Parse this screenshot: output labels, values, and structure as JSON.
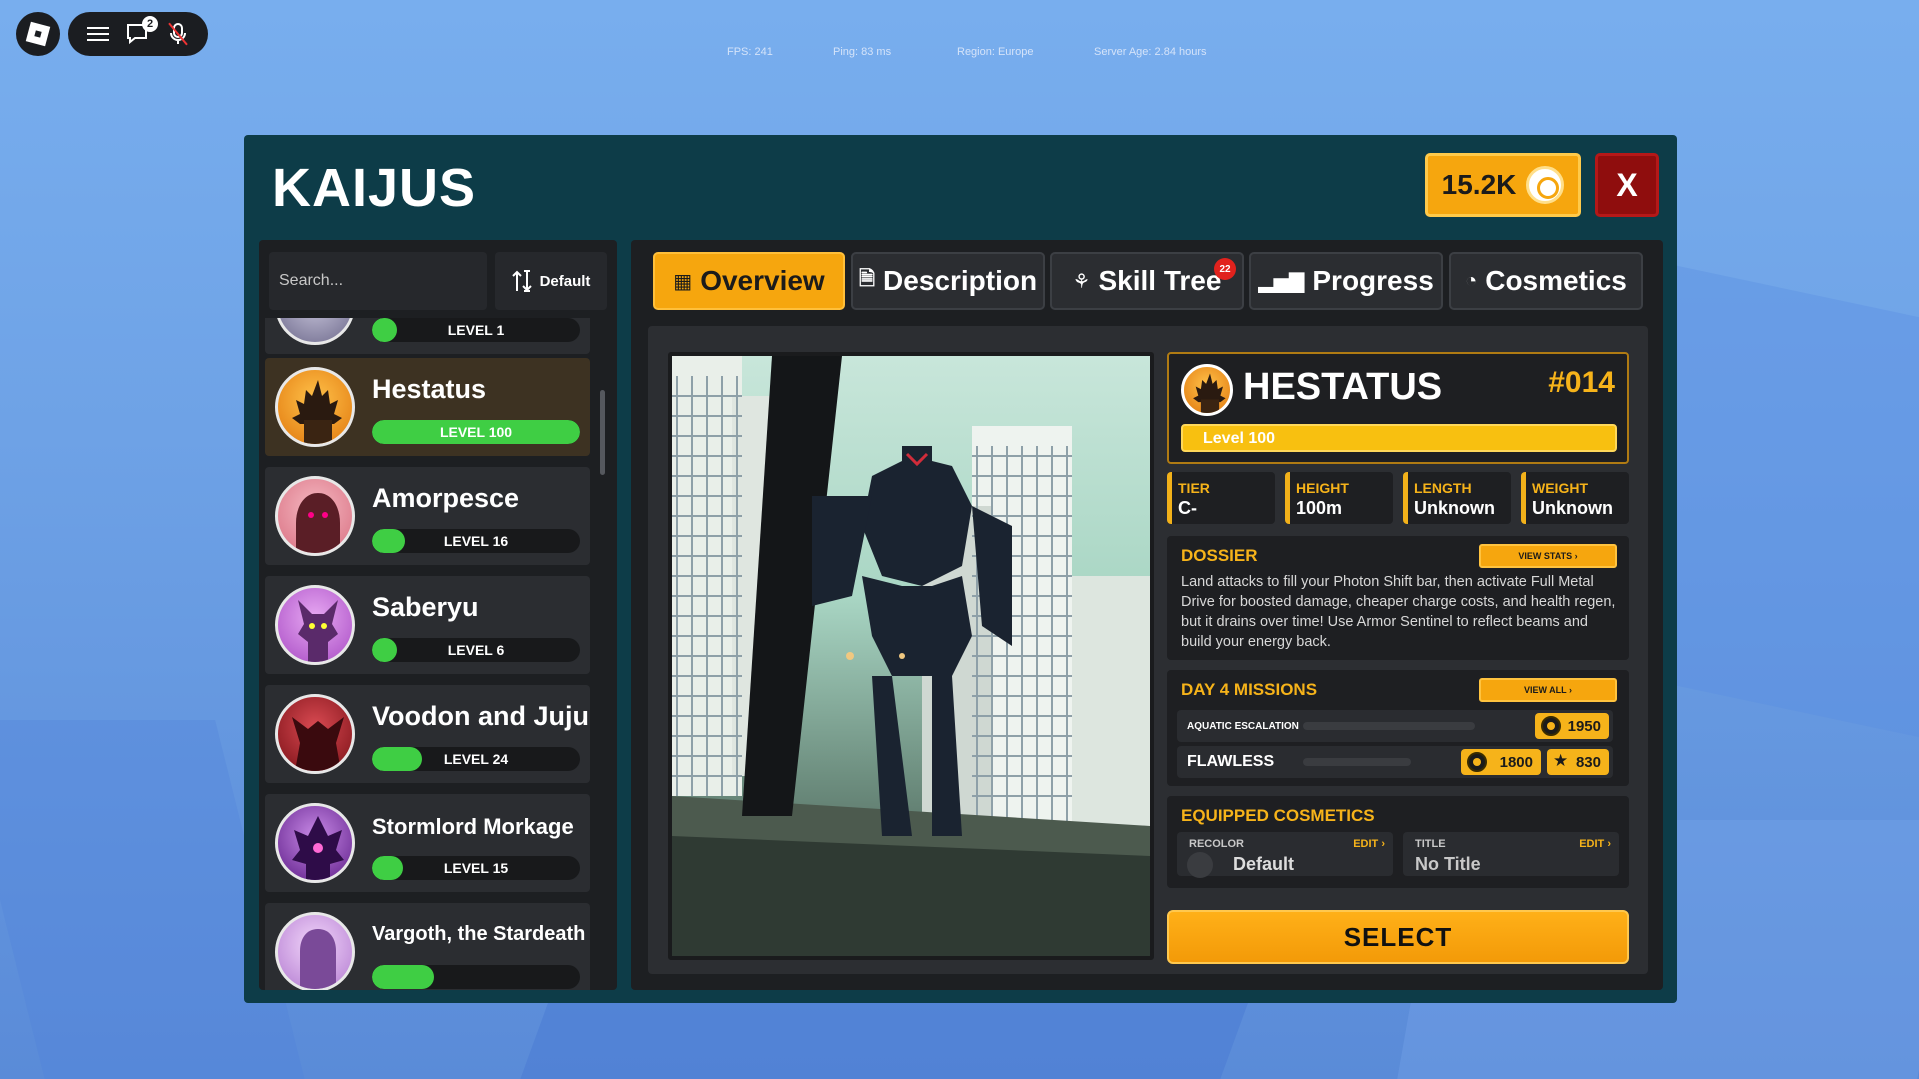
{
  "topbar": {
    "chat_badge": "2",
    "stats": {
      "fps": "FPS: 241",
      "ping": "Ping: 83 ms",
      "region": "Region: Europe",
      "server_age": "Server Age: 2.84 hours"
    }
  },
  "panel": {
    "title": "KAIJUS",
    "currency": "15.2K",
    "close_label": "X"
  },
  "left": {
    "search_placeholder": "Search...",
    "sort_label": "Default",
    "items": [
      {
        "name": "",
        "level": "LEVEL 1",
        "progress": 0.04,
        "avatar_color": "#8a86a8"
      },
      {
        "name": "Hestatus",
        "level": "LEVEL 100",
        "progress": 1.0,
        "avatar_color": "#f39a1e",
        "selected": true
      },
      {
        "name": "Amorpesce",
        "level": "LEVEL 16",
        "progress": 0.16,
        "avatar_color": "#e98a9a"
      },
      {
        "name": "Saberyu",
        "level": "LEVEL 6",
        "progress": 0.06,
        "avatar_color": "#c96ad6"
      },
      {
        "name": "Voodon and Juju",
        "level": "LEVEL 24",
        "progress": 0.24,
        "avatar_color": "#b52a33"
      },
      {
        "name": "Stormlord Morkage",
        "level": "LEVEL 15",
        "progress": 0.15,
        "avatar_color": "#8b3ab8"
      },
      {
        "name": "Vargoth, the Stardeath",
        "level": "",
        "progress": 0.3,
        "avatar_color": "#d7a4e6"
      }
    ]
  },
  "tabs": [
    {
      "label": "Overview",
      "icon": "overview-icon",
      "active": true
    },
    {
      "label": "Description",
      "icon": "document-icon"
    },
    {
      "label": "Skill Tree",
      "icon": "skill-tree-icon",
      "badge": "22"
    },
    {
      "label": "Progress",
      "icon": "chart-icon"
    },
    {
      "label": "Cosmetics",
      "icon": "palette-icon"
    }
  ],
  "kaiju": {
    "name": "HESTATUS",
    "number": "#014",
    "level_text": "Level 100",
    "stats": [
      {
        "key": "TIER",
        "value": "C-"
      },
      {
        "key": "HEIGHT",
        "value": "100m"
      },
      {
        "key": "LENGTH",
        "value": "Unknown"
      },
      {
        "key": "WEIGHT",
        "value": "Unknown"
      }
    ],
    "dossier_title": "DOSSIER",
    "dossier_button": "VIEW STATS ›",
    "dossier_text": "Land attacks to fill your Photon Shift bar, then activate Full Metal Drive for boosted damage, cheaper charge costs, and health regen, but it drains over time! Use Armor Sentinel to reflect beams and build your energy back.",
    "missions_title": "DAY 4 MISSIONS",
    "missions_button": "VIEW ALL ›",
    "missions": [
      {
        "name": "AQUATIC ESCALATION",
        "coin_reward": "1950",
        "star_reward": "",
        "progress": 0
      },
      {
        "name": "FLAWLESS",
        "coin_reward": "1800",
        "star_reward": "830",
        "progress": 0
      }
    ],
    "cosmetics_title": "EQUIPPED COSMETICS",
    "cosmetics": [
      {
        "key": "RECOLOR",
        "edit": "EDIT ›",
        "value": "Default"
      },
      {
        "key": "TITLE",
        "edit": "EDIT ›",
        "value": "No Title"
      }
    ],
    "select_label": "SELECT"
  }
}
